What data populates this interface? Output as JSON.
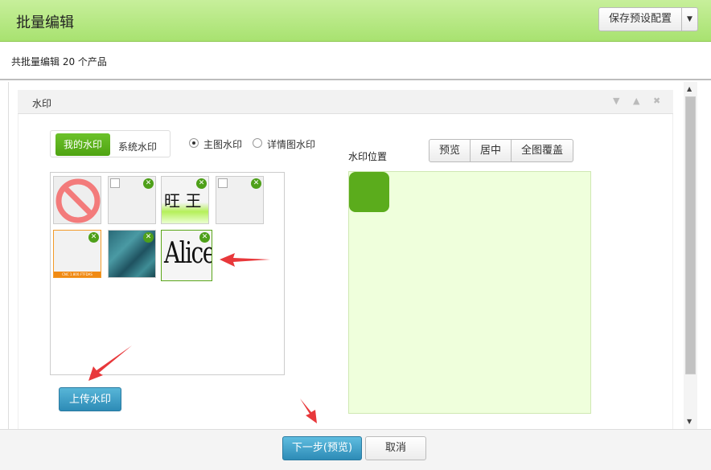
{
  "window": {
    "title": "批量编辑"
  },
  "toolbar": {
    "count_text": "共批量编辑 20 个产品",
    "save_preset_label": "保存预设配置"
  },
  "panel": {
    "title": "水印"
  },
  "tabs": [
    {
      "label": "我的水印",
      "active": true
    },
    {
      "label": "系统水印",
      "active": false
    }
  ],
  "radios": [
    {
      "label": "主图水印",
      "checked": true
    },
    {
      "label": "详情图水印",
      "checked": false
    }
  ],
  "watermarks": [
    {
      "kind": "none-icon"
    },
    {
      "kind": "broken-image"
    },
    {
      "kind": "wangwang-image",
      "text": "旺 王"
    },
    {
      "kind": "broken-image"
    },
    {
      "kind": "orange-border-image",
      "text": "CNC 1.800.FTFDAS"
    },
    {
      "kind": "sea-image"
    },
    {
      "kind": "alice-image",
      "text": "Alice",
      "selected": true
    }
  ],
  "upload_label": "上传水印",
  "position": {
    "label": "水印位置",
    "buttons": [
      "预览",
      "居中",
      "全图覆盖"
    ]
  },
  "footer": {
    "next_label": "下一步(预览)",
    "cancel_label": "取消"
  },
  "colors": {
    "accent_green": "#5bac1c",
    "title_green": "#a8e270",
    "primary_blue": "#2d8bb6",
    "preview_bg": "#efffdc",
    "arrow_red": "#e8383b"
  }
}
